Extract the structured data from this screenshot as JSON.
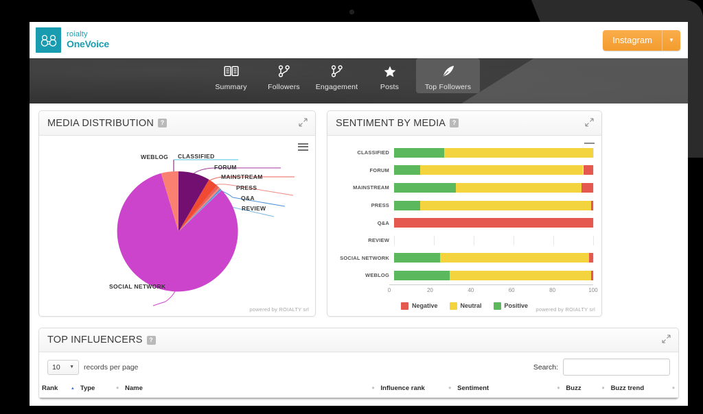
{
  "brand": {
    "name_top": "roialty",
    "name_bottom": "OneVoice",
    "logo_color": "#1a9cb0"
  },
  "topbar": {
    "channel_button": {
      "label": "Instagram",
      "caret": "▼",
      "color": "#f49c2e"
    }
  },
  "nav": {
    "items": [
      {
        "label": "Summary",
        "icon": "book-icon",
        "active": false
      },
      {
        "label": "Followers",
        "icon": "network-icon",
        "active": false
      },
      {
        "label": "Engagement",
        "icon": "network-icon",
        "active": false
      },
      {
        "label": "Posts",
        "icon": "star-icon",
        "active": false
      },
      {
        "label": "Top Followers",
        "icon": "feather-icon",
        "active": true
      }
    ]
  },
  "panels": {
    "media_distribution": {
      "title": "MEDIA DISTRIBUTION",
      "help": "?",
      "expand_icon": "expand-icon",
      "menu_icon": "hamburger-menu-icon",
      "footer": "powered by ROIALTY srl"
    },
    "sentiment_by_media": {
      "title": "SENTIMENT BY MEDIA",
      "help": "?",
      "expand_icon": "expand-icon",
      "menu_icon": "hamburger-menu-icon",
      "footer": "powered by ROIALTY srl"
    },
    "top_influencers": {
      "title": "TOP INFLUENCERS",
      "help": "?",
      "expand_icon": "expand-icon",
      "records_value": "10",
      "records_caret": "▼",
      "records_label": "records per page",
      "search_label": "Search:",
      "search_value": "",
      "search_placeholder": "",
      "columns": [
        {
          "label": "Rank",
          "sort": "asc"
        },
        {
          "label": "Type",
          "sort": "none"
        },
        {
          "label": "Name",
          "sort": "none"
        },
        {
          "label": "Influence rank",
          "sort": "none"
        },
        {
          "label": "Sentiment",
          "sort": "none"
        },
        {
          "label": "Buzz",
          "sort": "none"
        },
        {
          "label": "Buzz trend",
          "sort": "none"
        }
      ]
    }
  },
  "chart_data": [
    {
      "type": "pie",
      "title": "MEDIA DISTRIBUTION",
      "labels": [
        "SOCIAL NETWORK",
        "CLASSIFIED",
        "WEBLOG",
        "FORUM",
        "MAINSTREAM",
        "PRESS",
        "Q&A",
        "REVIEW"
      ],
      "values": [
        81.5,
        8.0,
        5.8,
        3.0,
        0.7,
        0.5,
        0.3,
        0.2
      ],
      "colors": [
        "#cc44cc",
        "#720f70",
        "#fa8072",
        "#f04b32",
        "#e8625a",
        "#f08a7e",
        "#4a90d9",
        "#7ab8e8"
      ],
      "legend": "labels-with-leader-lines",
      "grid": false
    },
    {
      "type": "bar",
      "orientation": "horizontal",
      "stacked": true,
      "title": "SENTIMENT BY MEDIA",
      "categories": [
        "CLASSIFIED",
        "FORUM",
        "MAINSTREAM",
        "PRESS",
        "Q&A",
        "REVIEW",
        "SOCIAL NETWORK",
        "WEBLOG"
      ],
      "series": [
        {
          "name": "Positive",
          "color": "#5cb85c",
          "values": [
            25,
            13,
            31,
            13,
            0,
            0,
            23,
            28
          ]
        },
        {
          "name": "Neutral",
          "color": "#f3d43f",
          "values": [
            75,
            82,
            63,
            86,
            0,
            0,
            75,
            71
          ]
        },
        {
          "name": "Negative",
          "color": "#e4584f",
          "values": [
            0,
            5,
            6,
            1,
            100,
            0,
            2,
            1
          ]
        }
      ],
      "xlabel": "",
      "ylabel": "",
      "xlim": [
        0,
        100
      ],
      "xticks": [
        "0",
        "20",
        "40",
        "60",
        "80",
        "100"
      ],
      "legend_position": "bottom",
      "grid": true
    }
  ]
}
